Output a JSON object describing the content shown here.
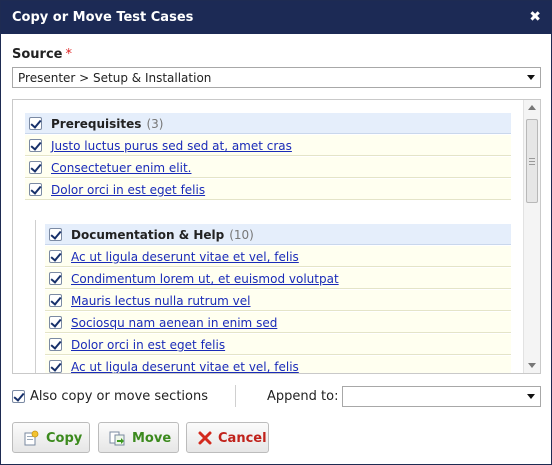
{
  "dialog": {
    "title": "Copy or Move Test Cases",
    "close_glyph": "✖"
  },
  "source": {
    "label": "Source",
    "required_mark": "*",
    "selected": "Presenter > Setup & Installation"
  },
  "tree": {
    "section1": {
      "name": "Prerequisites",
      "count": "(3)",
      "checked": true,
      "cases": [
        "Justo luctus purus sed sed at, amet cras",
        "Consectetuer enim elit.",
        "Dolor orci in est eget felis"
      ]
    },
    "section2": {
      "name": "Documentation & Help",
      "count": "(10)",
      "checked": true,
      "cases": [
        "Ac ut ligula deserunt vitae et vel, felis",
        "Condimentum lorem ut, et euismod volutpat",
        "Mauris lectus nulla rutrum vel",
        "Sociosqu nam aenean in enim sed",
        "Dolor orci in est eget felis",
        "Ac ut ligula deserunt vitae et vel, felis"
      ]
    }
  },
  "options": {
    "also_copy_label": "Also copy or move sections",
    "also_copy_checked": true,
    "append_label": "Append to:",
    "append_value": ""
  },
  "buttons": {
    "copy": "Copy",
    "move": "Move",
    "cancel": "Cancel"
  },
  "icons": {
    "close": "close-icon",
    "copy": "copy-icon",
    "move": "move-icon",
    "cancel": "cancel-icon",
    "scroll_up": "scroll-up-icon",
    "scroll_down": "scroll-down-icon",
    "dropdown": "chevron-down-icon",
    "checkbox": "checkbox-checked-icon"
  },
  "colors": {
    "titlebar": "#1c2a55",
    "link": "#1a2bb8",
    "header_row": "#e5eefb",
    "case_row": "#fffff0",
    "copy_move_text": "#3c8a1e",
    "cancel_text": "#c0221b",
    "required": "#dd2222"
  }
}
